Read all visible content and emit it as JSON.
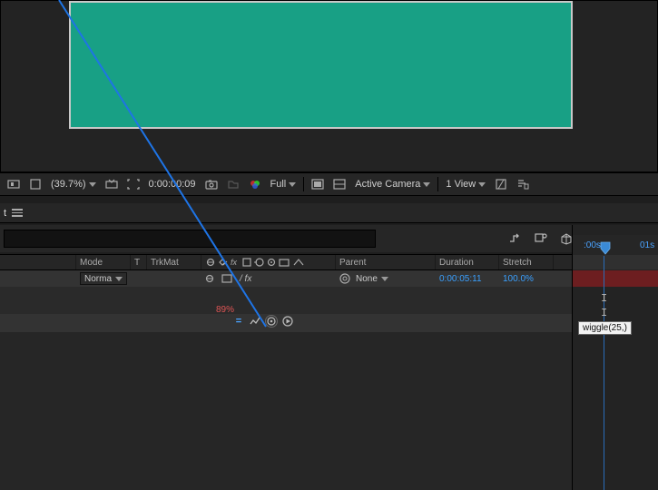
{
  "preview": {
    "zoom": "(39.7%)",
    "timecode": "0:00:00:09",
    "quality": "Full",
    "camera": "Active Camera",
    "view": "1 View"
  },
  "panel": {
    "tab_label": "t"
  },
  "cols": {
    "mode": "Mode",
    "t": "T",
    "trkmat": "TrkMat",
    "parent": "Parent",
    "duration": "Duration",
    "stretch": "Stretch"
  },
  "layer": {
    "mode_value": "Norma",
    "parent_value": "None",
    "duration": "0:00:05:11",
    "stretch": "100.0%"
  },
  "prop": {
    "percent": "89%"
  },
  "timeline": {
    "t0": ":00s",
    "t1": "01s",
    "expression": "wiggle(25,)"
  }
}
